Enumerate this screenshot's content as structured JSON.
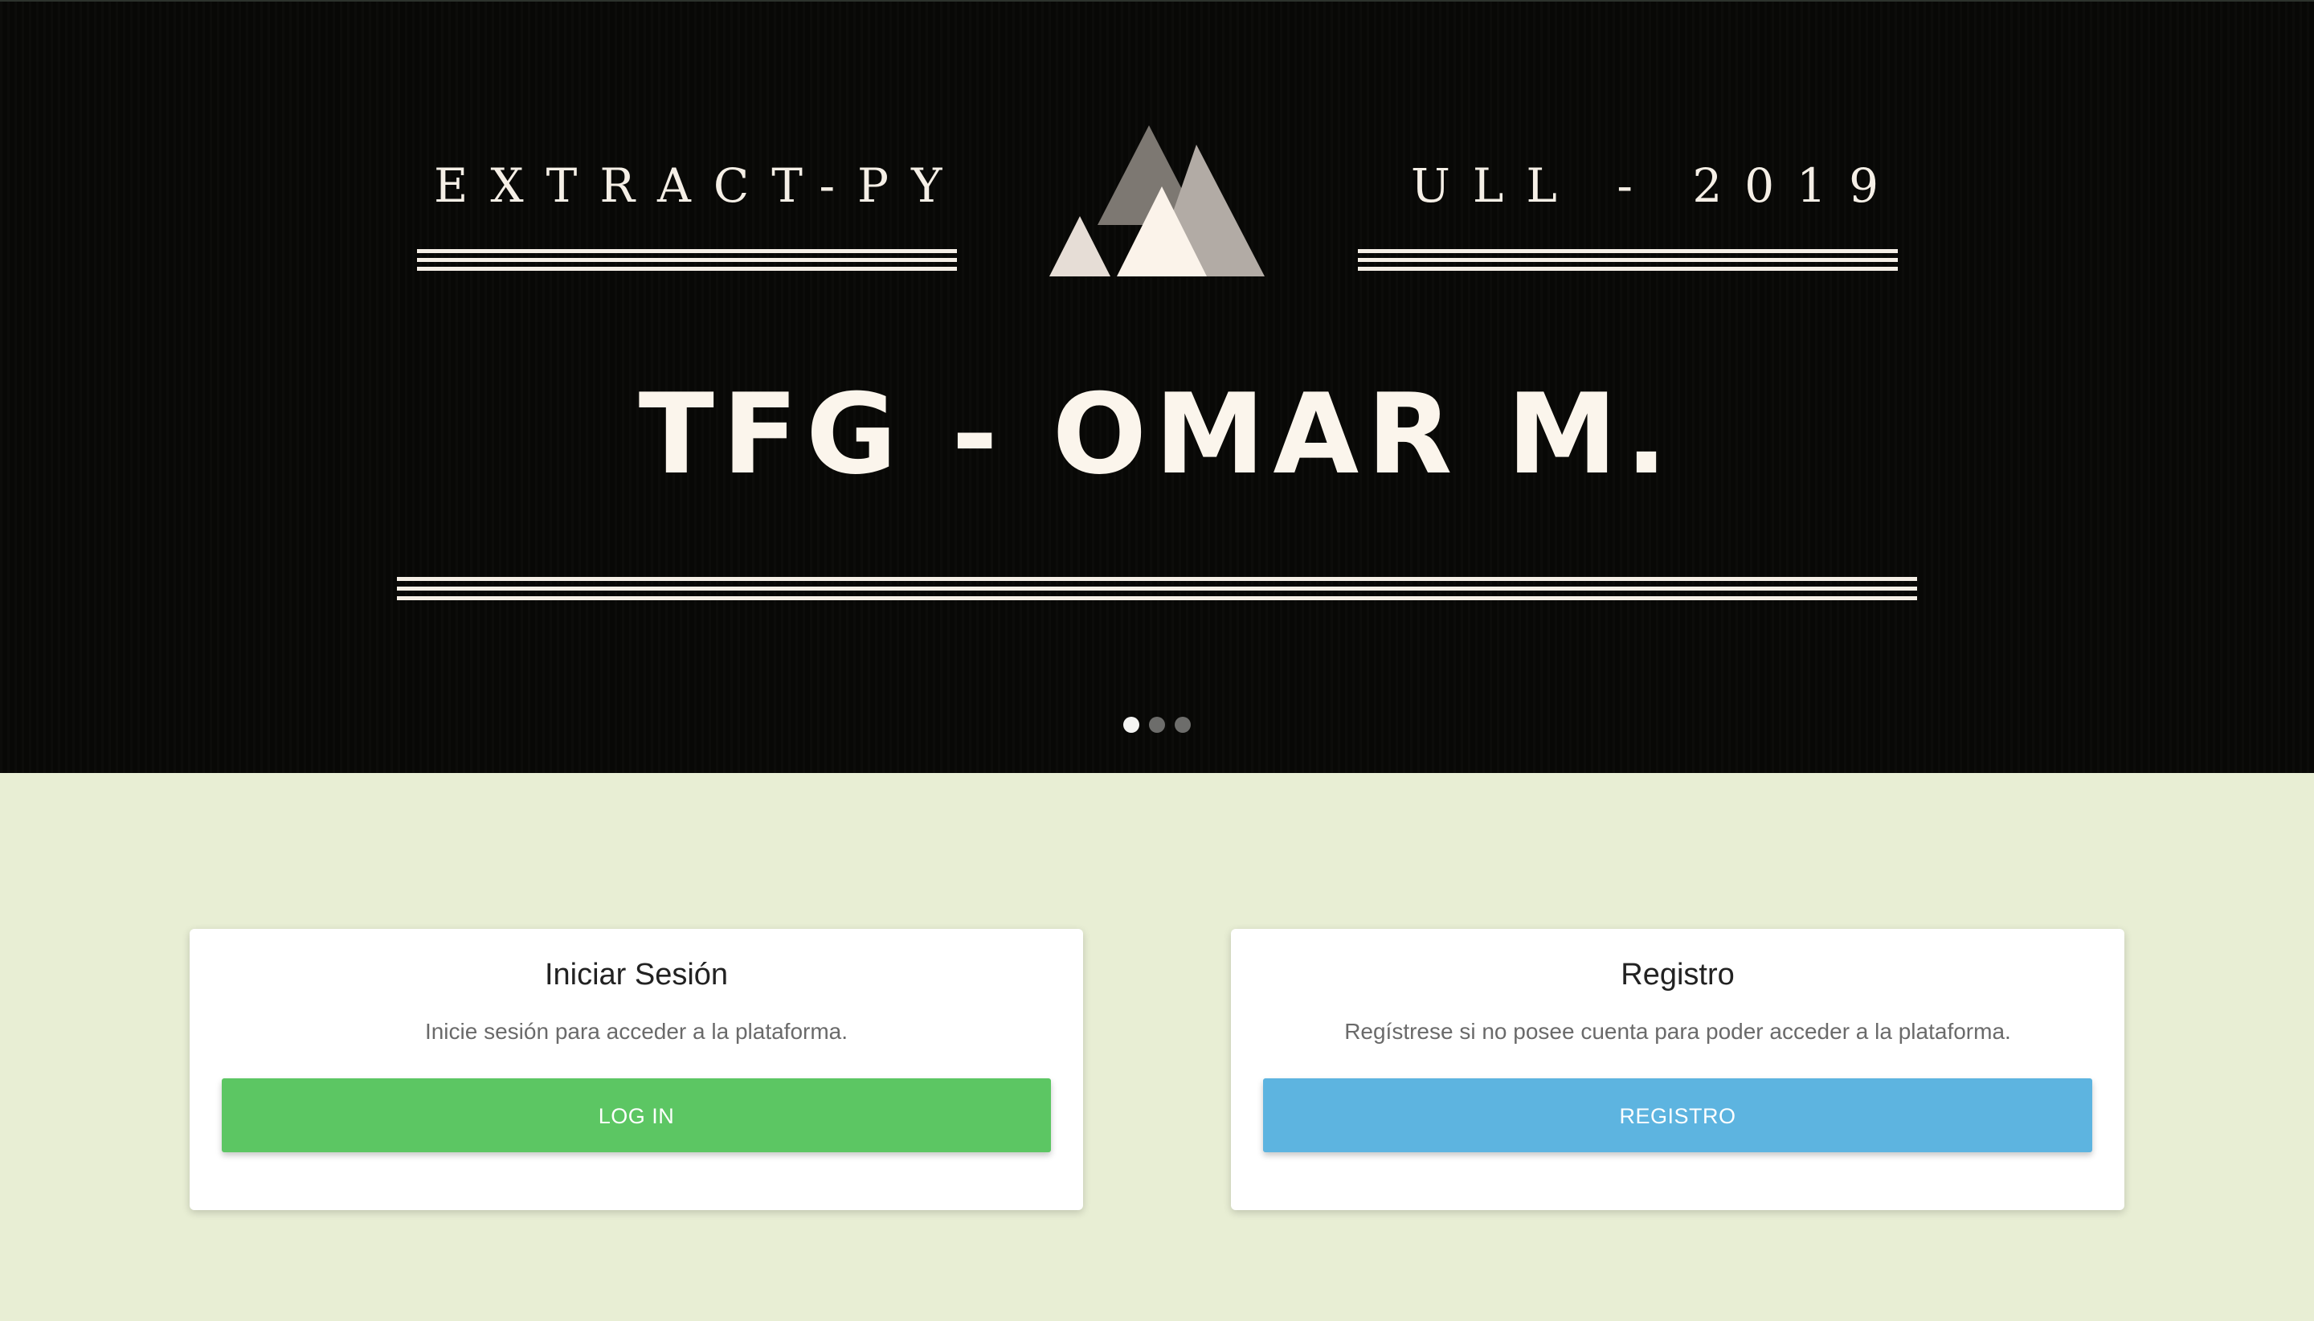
{
  "hero": {
    "left_text": "EXTRACT-PY",
    "right_text": "ULL - 2019",
    "title": "TFG - OMAR M.",
    "logo_icon": "mountain-logo-icon",
    "slides": [
      {
        "active": true
      },
      {
        "active": false
      },
      {
        "active": false
      }
    ]
  },
  "login_card": {
    "title": "Iniciar Sesión",
    "description": "Inicie sesión para acceder a la plataforma.",
    "button_label": "LOG IN",
    "button_color": "#5cc663"
  },
  "register_card": {
    "title": "Registro",
    "description": "Regístrese si no posee cuenta para poder acceder a la plataforma.",
    "button_label": "REGISTRO",
    "button_color": "#5db4e0"
  },
  "colors": {
    "page_background": "#e8eed4",
    "hero_background": "#080806",
    "hero_text": "#f5efe6"
  }
}
